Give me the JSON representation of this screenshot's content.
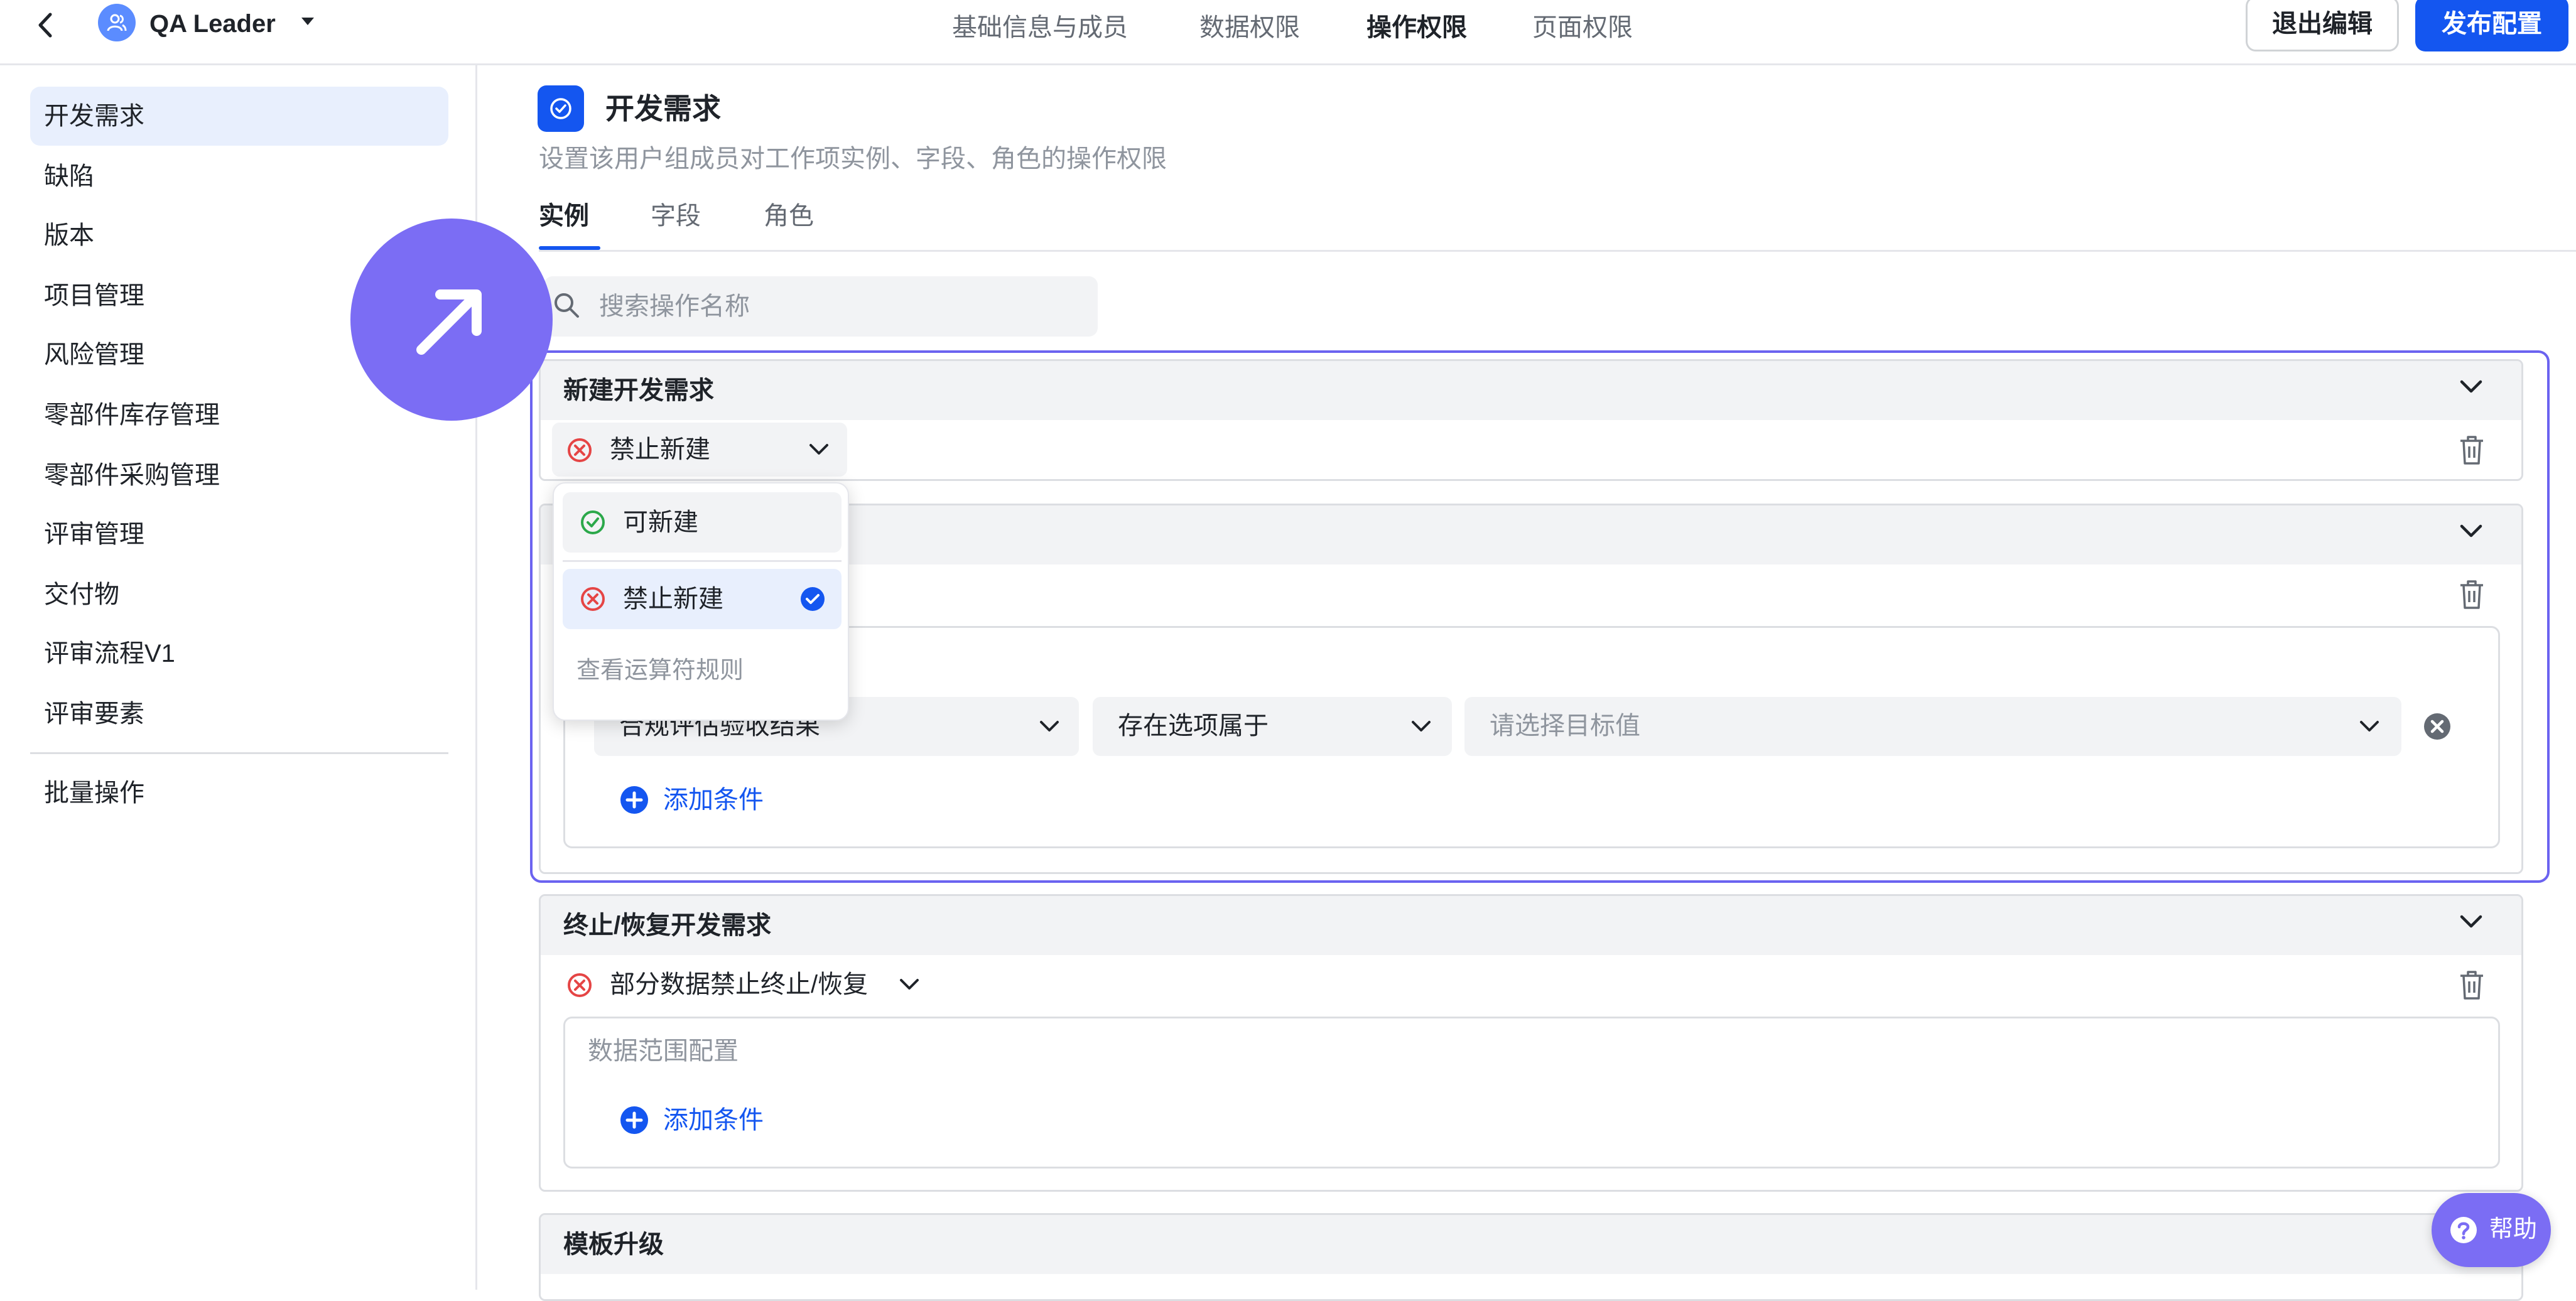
{
  "header": {
    "group_name": "QA Leader",
    "tabs": [
      {
        "label": "基础信息与成员"
      },
      {
        "label": "数据权限"
      },
      {
        "label": "操作权限"
      },
      {
        "label": "页面权限"
      }
    ],
    "exit_label": "退出编辑",
    "publish_label": "发布配置"
  },
  "sidebar": {
    "items": [
      {
        "label": "开发需求"
      },
      {
        "label": "缺陷"
      },
      {
        "label": "版本"
      },
      {
        "label": "项目管理"
      },
      {
        "label": "风险管理"
      },
      {
        "label": "零部件库存管理"
      },
      {
        "label": "零部件采购管理"
      },
      {
        "label": "评审管理"
      },
      {
        "label": "交付物"
      },
      {
        "label": "评审流程V1"
      },
      {
        "label": "评审要素"
      }
    ],
    "batch_label": "批量操作"
  },
  "main": {
    "title": "开发需求",
    "description": "设置该用户组成员对工作项实例、字段、角色的操作权限",
    "tabs": [
      {
        "label": "实例"
      },
      {
        "label": "字段"
      },
      {
        "label": "角色"
      }
    ],
    "search_placeholder": "搜索操作名称",
    "panels": [
      {
        "title": "新建开发需求",
        "permission": "禁止新建"
      },
      {
        "condition": {
          "field": "合规评估验收结果",
          "operator": "存在选项属于",
          "value_placeholder": "请选择目标值"
        },
        "add_condition": "添加条件"
      },
      {
        "title": "终止/恢复开发需求",
        "permission": "部分数据禁止终止/恢复",
        "range_label": "数据范围配置",
        "add_condition": "添加条件"
      },
      {
        "title": "模板升级"
      }
    ]
  },
  "dropdown": {
    "options": [
      {
        "label": "可新建"
      },
      {
        "label": "禁止新建"
      }
    ],
    "footer": "查看运算符规则"
  },
  "help": {
    "label": "帮助"
  },
  "colors": {
    "accent": "#1456f0",
    "allow": "#2ba84a",
    "deny": "#e54545",
    "cursor": "#7b6df4"
  }
}
